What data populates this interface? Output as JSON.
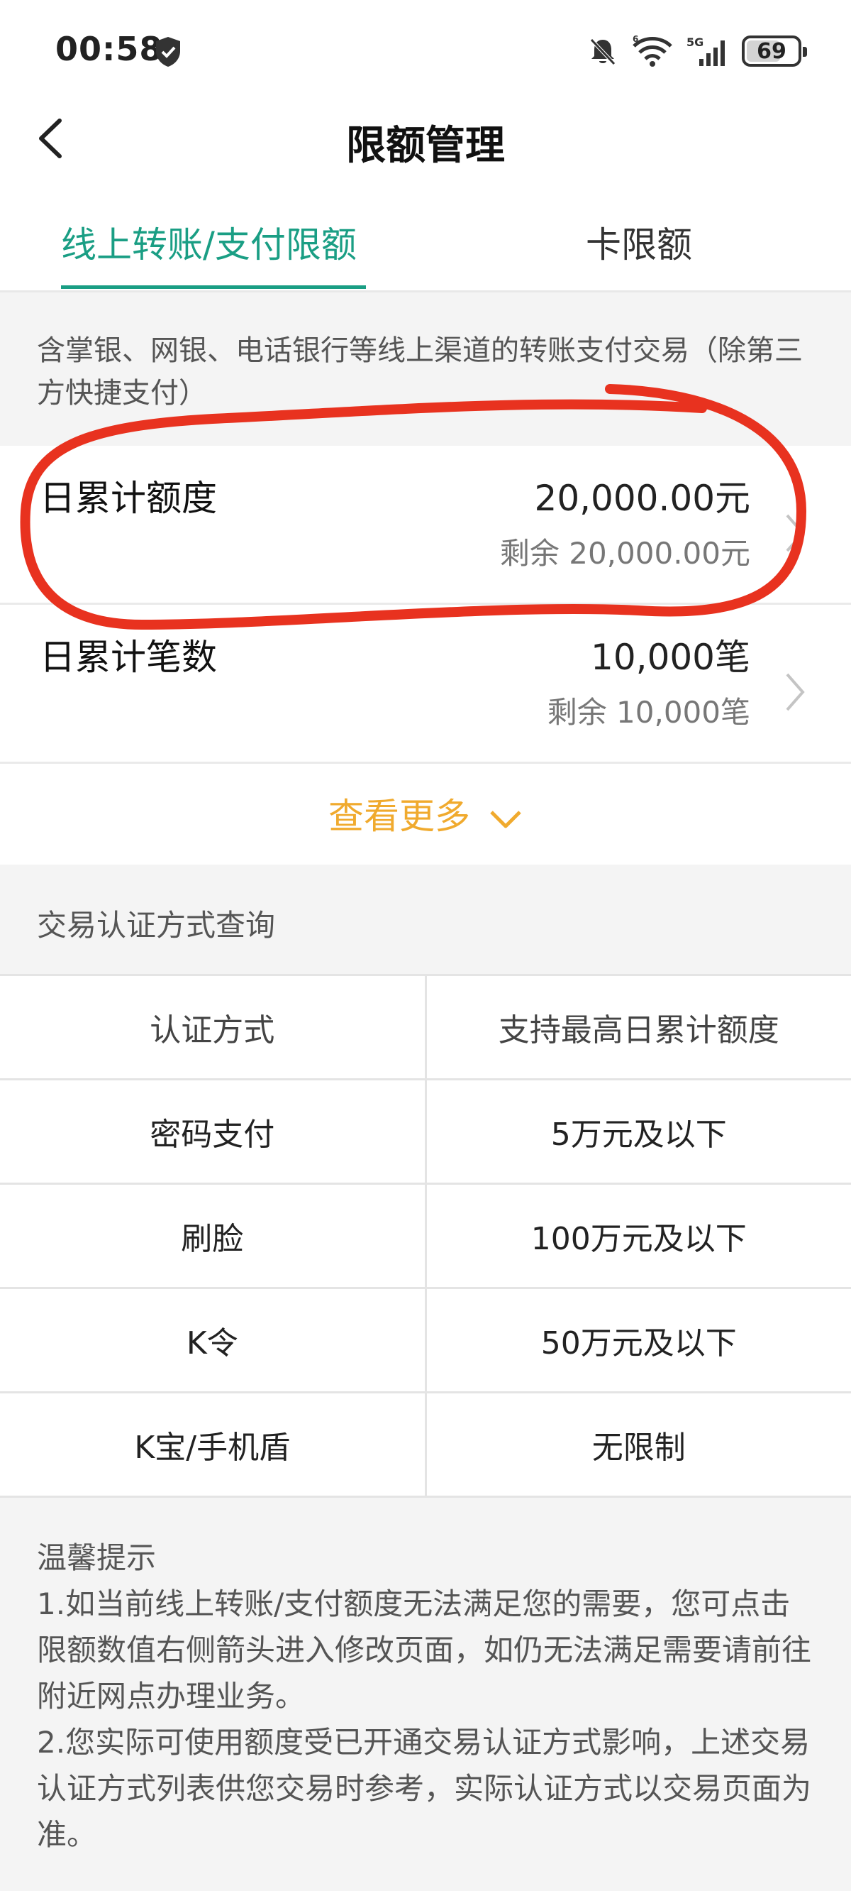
{
  "status_bar": {
    "time": "00:58",
    "battery": "69",
    "network": "5G"
  },
  "header": {
    "title": "限额管理"
  },
  "tabs": [
    {
      "label": "线上转账/支付限额",
      "active": true
    },
    {
      "label": "卡限额",
      "active": false
    }
  ],
  "description": "含掌银、网银、电话银行等线上渠道的转账支付交易（除第三方快捷支付）",
  "limits": [
    {
      "label": "日累计额度",
      "value": "20,000.00元",
      "remaining": "剩余 20,000.00元"
    },
    {
      "label": "日累计笔数",
      "value": "10,000笔",
      "remaining": "剩余 10,000笔"
    }
  ],
  "more_label": "查看更多",
  "auth_section": {
    "title": "交易认证方式查询",
    "headers": [
      "认证方式",
      "支持最高日累计额度"
    ],
    "rows": [
      [
        "密码支付",
        "5万元及以下"
      ],
      [
        "刷脸",
        "100万元及以下"
      ],
      [
        "K令",
        "50万元及以下"
      ],
      [
        "K宝/手机盾",
        "无限制"
      ]
    ]
  },
  "tips": {
    "title": "温馨提示",
    "items": [
      "1.如当前线上转账/支付额度无法满足您的需要，您可点击限额数值右侧箭头进入修改页面，如仍无法满足需要请前往附近网点办理业务。",
      "2.您实际可使用额度受已开通交易认证方式影响，上述交易认证方式列表供您交易时参考，实际认证方式以交易页面为准。"
    ]
  },
  "colors": {
    "accent": "#1a9e84",
    "more": "#f0aa2e",
    "annotation": "#e8321f"
  }
}
